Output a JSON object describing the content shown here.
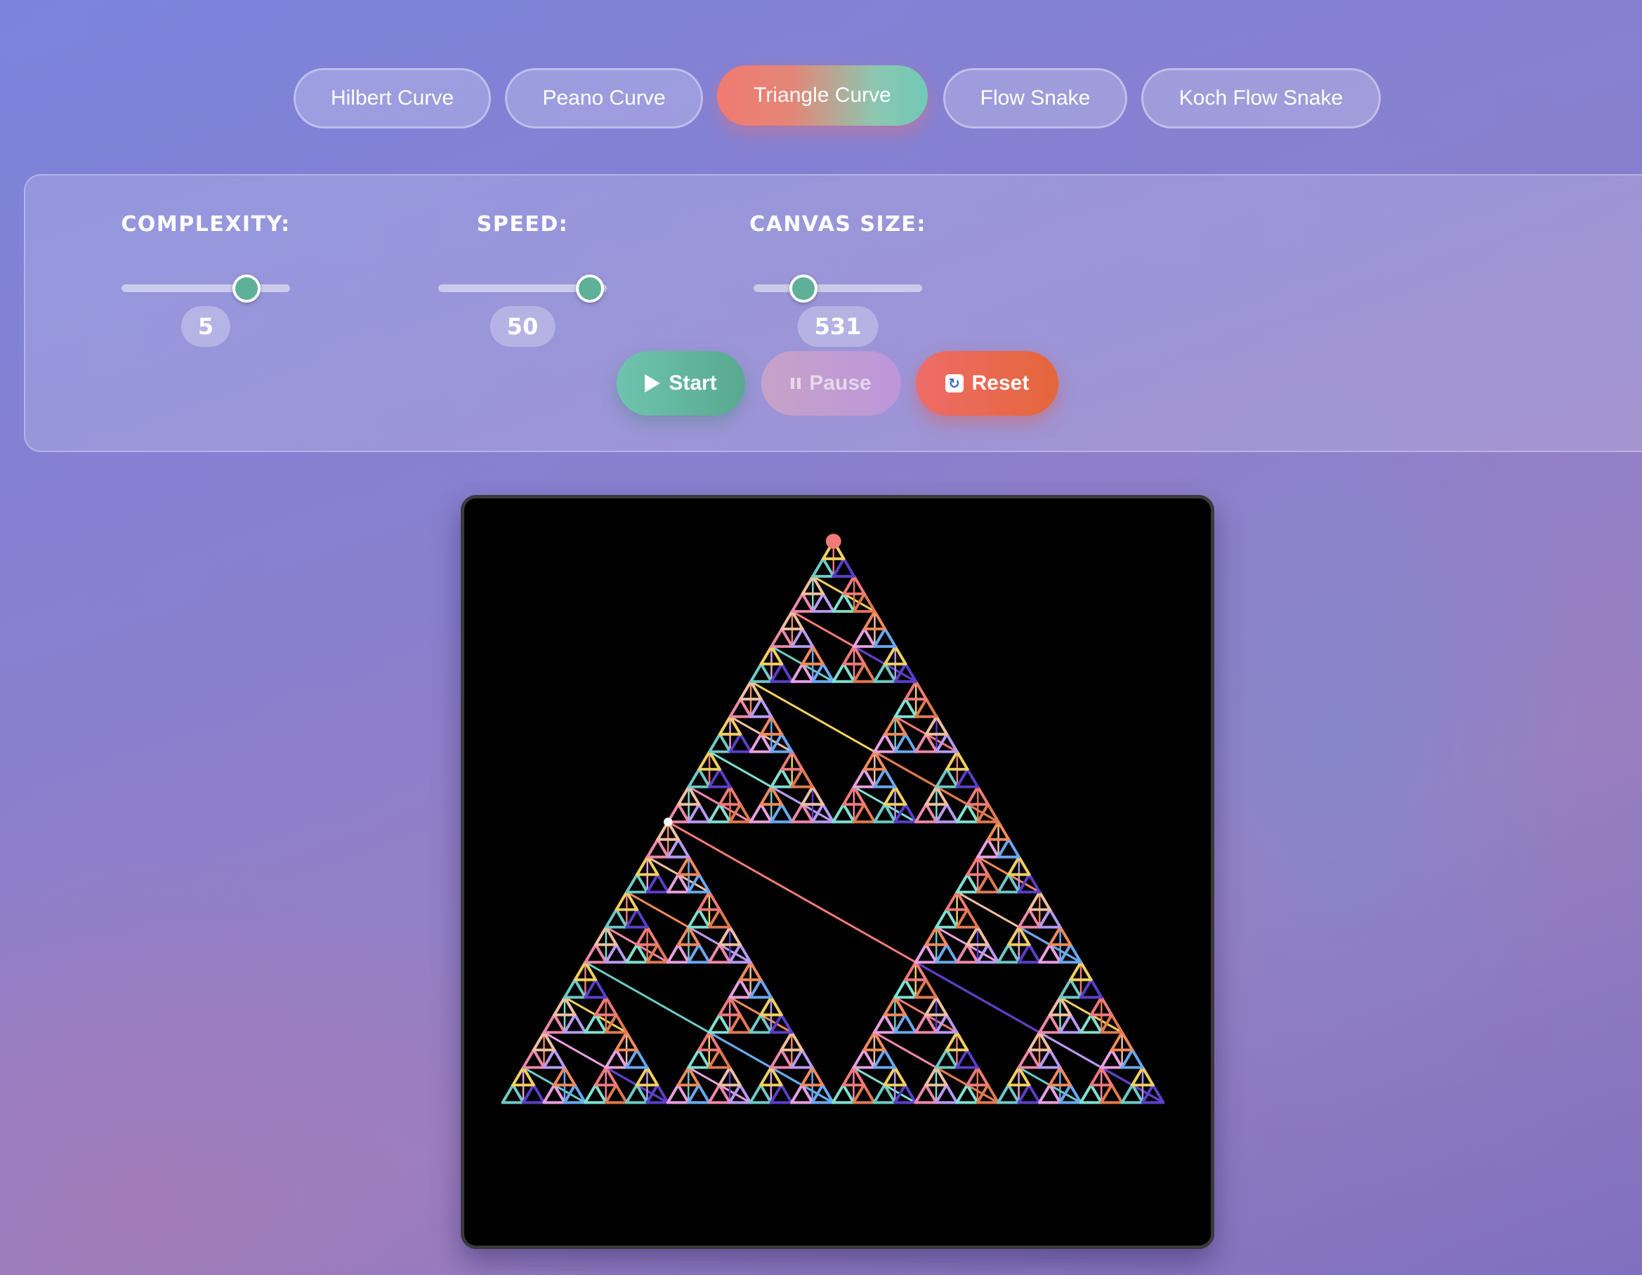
{
  "tabs": [
    {
      "label": "Hilbert Curve",
      "active": false
    },
    {
      "label": "Peano Curve",
      "active": false
    },
    {
      "label": "Triangle Curve",
      "active": true
    },
    {
      "label": "Flow Snake",
      "active": false
    },
    {
      "label": "Koch Flow Snake",
      "active": false
    }
  ],
  "controls": {
    "complexity": {
      "label": "COMPLEXITY:",
      "value": "5"
    },
    "speed": {
      "label": "SPEED:",
      "value": "50"
    },
    "canvas_size": {
      "label": "CANVAS SIZE:",
      "value": "531"
    }
  },
  "buttons": {
    "start": {
      "label": "Start",
      "icon": "play-icon"
    },
    "pause": {
      "label": "Pause",
      "icon": "pause-icon",
      "disabled": true
    },
    "reset": {
      "label": "Reset",
      "icon": "reset-icon"
    }
  },
  "canvas": {
    "background": "#000000",
    "palette": [
      "#f07a78",
      "#6ec9c5",
      "#5a3fc8",
      "#f0d060",
      "#e8a0e0",
      "#6aa8f0",
      "#f08a5a",
      "#ee88aa",
      "#b89af0",
      "#f0c0a0",
      "#80e0d0",
      "#e07a50"
    ]
  }
}
